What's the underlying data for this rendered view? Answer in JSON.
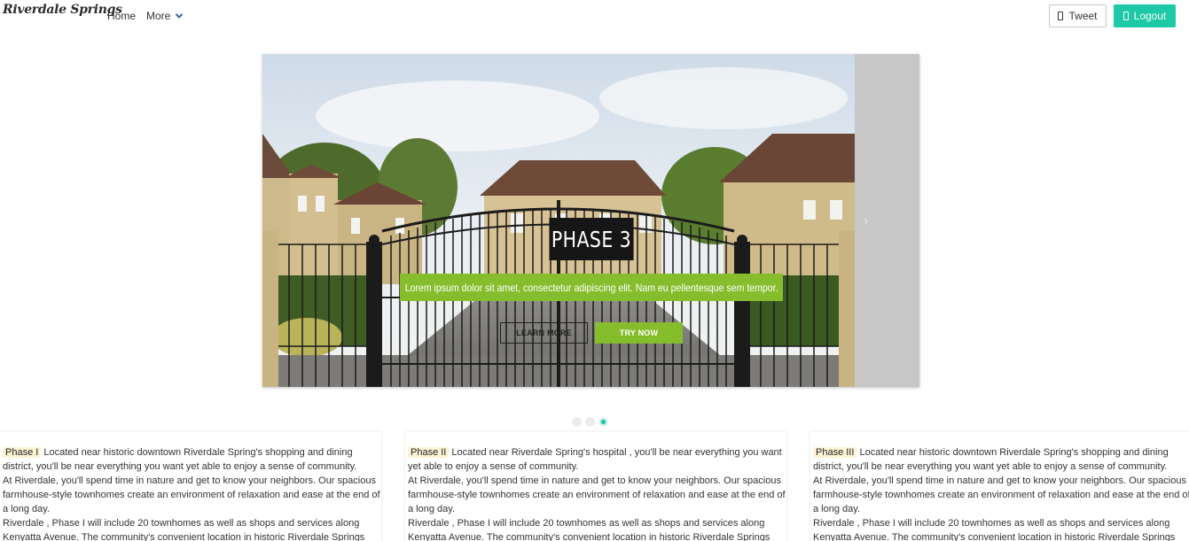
{
  "navbar": {
    "brand": "Riverdale Springs",
    "home_label": "Home",
    "more_label": "More",
    "tweet_label": "Tweet",
    "logout_label": "Logout",
    "accent_color": "#1ec9a5"
  },
  "carousel": {
    "slide_title": "PHASE 3",
    "slide_text": "Lorem ipsum dolor sit amet, consectetur adipiscing elit. Nam eu pellentesque sem tempor.",
    "learn_more_label": "LEARN MORE",
    "try_now_label": "TRY NOW",
    "next_arrow": "›",
    "caption_color": "#86bd2d",
    "slide_count": 3,
    "active_slide": 3
  },
  "cards": [
    {
      "tag": "Phase I",
      "intro": "Located near historic downtown Riverdale Spring's shopping and dining district, you'll be near everything you want yet able to enjoy a sense of community.",
      "para2": "At Riverdale, you'll spend time in nature and get to know your neighbors. Our spacious farmhouse-style townhomes create an environment of relaxation and ease at the end of a long day.",
      "para3": "Riverdale , Phase I will include 20 townhomes as well as shops and services along Kenyatta Avenue. The community's convenient location in historic Riverdale Springs"
    },
    {
      "tag": "Phase II",
      "intro": "Located near Riverdale Spring's hospital , you'll be near everything you want yet able to enjoy a sense of community.",
      "para2": "At Riverdale, you'll spend time in nature and get to know your neighbors. Our spacious farmhouse-style townhomes create an environment of relaxation and ease at the end of a long day.",
      "para3": "Riverdale , Phase I will include 20 townhomes as well as shops and services along Kenyatta Avenue. The community's convenient location in historic Riverdale Springs"
    },
    {
      "tag": "Phase III",
      "intro": "Located near historic downtown Riverdale Spring's shopping and dining district, you'll be near everything you want yet able to enjoy a sense of community.",
      "para2": "At Riverdale, you'll spend time in nature and get to know your neighbors. Our spacious farmhouse-style townhomes create an environment of relaxation and ease at the end of a long day.",
      "para3": "Riverdale , Phase I will include 20 townhomes as well as shops and services along Kenyatta Avenue. The community's convenient location in historic Riverdale Springs"
    }
  ]
}
